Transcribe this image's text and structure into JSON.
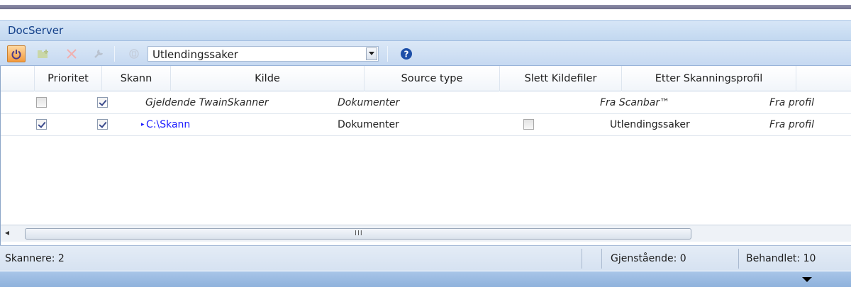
{
  "window": {
    "title": "DocServer"
  },
  "toolbar": {
    "power_icon": "power-icon",
    "add_icon": "add-folder-icon",
    "delete_icon": "delete-icon",
    "tool_icon": "wrench-icon",
    "copy_icon": "copy-icon",
    "profile_value": "Utlendingssaker",
    "help_icon": "help-icon"
  },
  "grid": {
    "columns": [
      "Prioritet",
      "Skann",
      "Kilde",
      "Source type",
      "Slett Kildefiler",
      "Etter Skanningsprofil"
    ],
    "rows": [
      {
        "prioritet": false,
        "skann": true,
        "kilde": "Gjeldende TwainSkanner",
        "source_type": "Dokumenter",
        "slett": "",
        "etter": "Fra Scanbar™",
        "extra": "Fra profil"
      },
      {
        "prioritet": true,
        "skann": true,
        "kilde": "C:\\Skann",
        "source_type": "Dokumenter",
        "slett": false,
        "etter": "Utlendingssaker",
        "extra": "Fra profil"
      }
    ],
    "scroll_left_glyph": "◂",
    "scroll_grip": "III"
  },
  "status": {
    "scanners": "Skannere: 2",
    "remaining": "Gjenstående: 0",
    "processed": "Behandlet: 10"
  },
  "colors": {
    "accent": "#c2d8f0",
    "link": "#1a1aff",
    "power": "#f39a3c"
  }
}
